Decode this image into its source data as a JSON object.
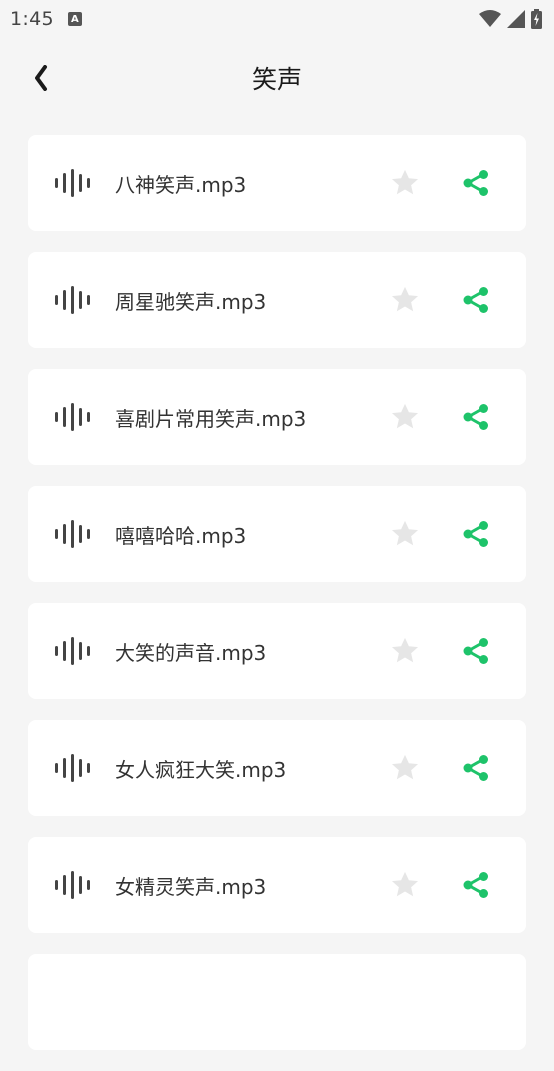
{
  "status": {
    "time": "1:45",
    "notification_badge": "A"
  },
  "header": {
    "title": "笑声"
  },
  "colors": {
    "accent": "#1ec36a",
    "star": "#e6e6e6",
    "wave": "#444444"
  },
  "files": [
    {
      "name": "八神笑声.mp3"
    },
    {
      "name": "周星驰笑声.mp3"
    },
    {
      "name": "喜剧片常用笑声.mp3"
    },
    {
      "name": "嘻嘻哈哈.mp3"
    },
    {
      "name": "大笑的声音.mp3"
    },
    {
      "name": "女人疯狂大笑.mp3"
    },
    {
      "name": "女精灵笑声.mp3"
    },
    {
      "name": ""
    }
  ]
}
